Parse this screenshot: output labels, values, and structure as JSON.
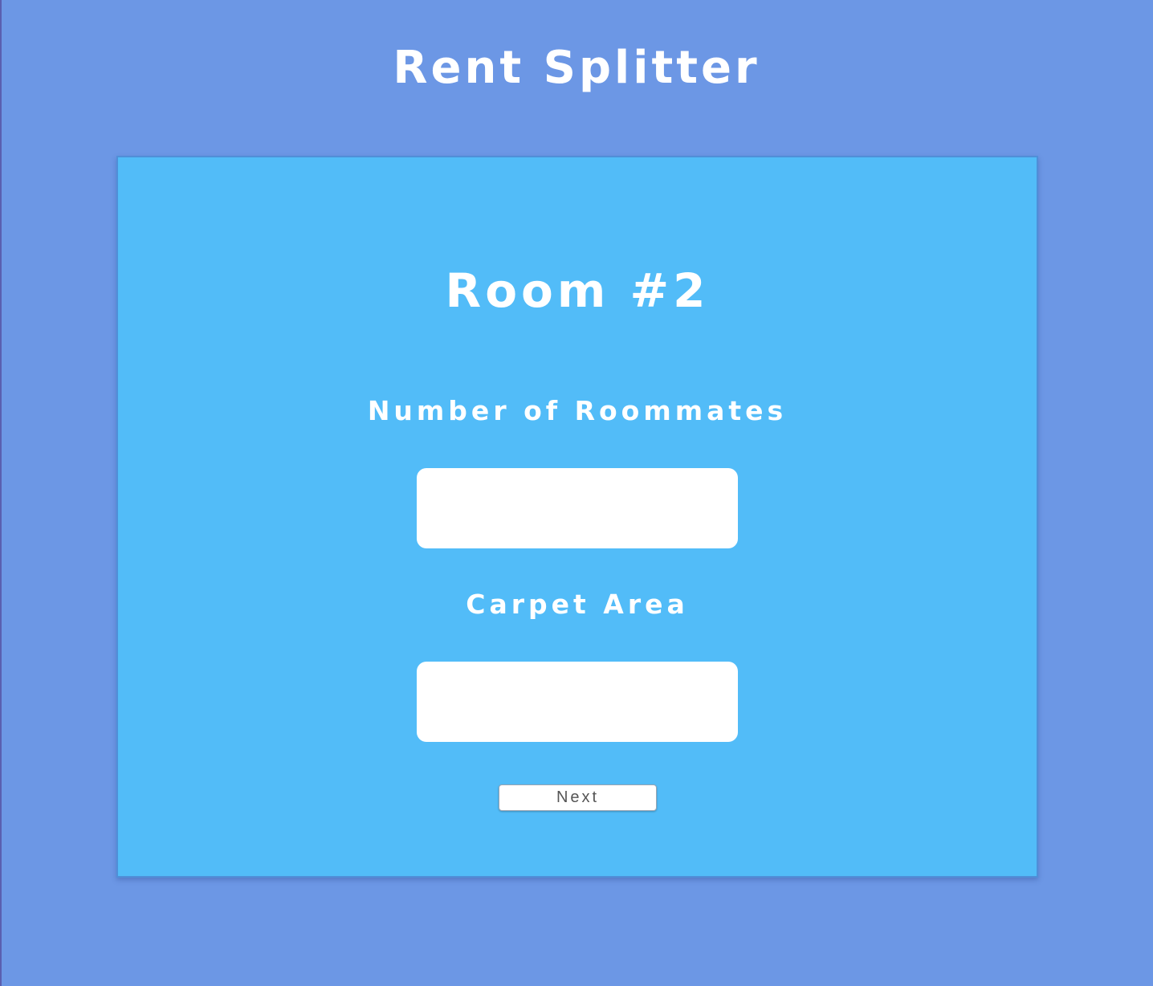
{
  "app": {
    "title": "Rent Splitter"
  },
  "form": {
    "room_title": "Room #2",
    "roommates_label": "Number of Roommates",
    "roommates_value": "",
    "area_label": "Carpet Area",
    "area_value": "",
    "next_label": "Next"
  },
  "colors": {
    "page_background": "#6c97e5",
    "card_background": "#52bcf8",
    "text": "#ffffff"
  }
}
